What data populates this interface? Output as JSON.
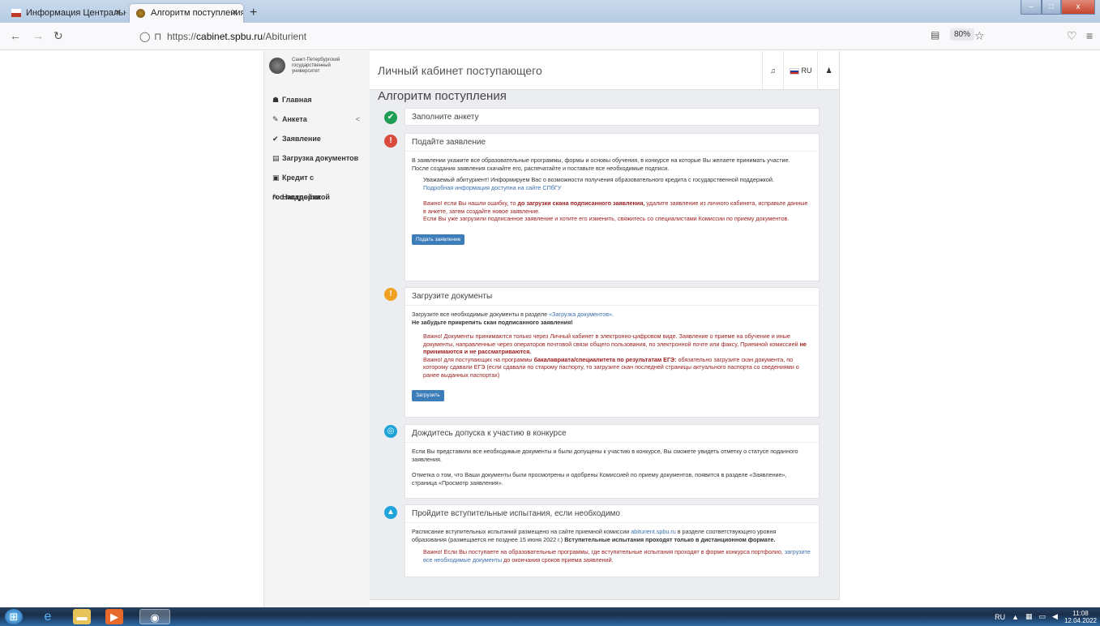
{
  "browser": {
    "tabs": [
      {
        "label": "Информация Центральной ко"
      },
      {
        "label": "Алгоритм поступления"
      }
    ],
    "new_tab": "+",
    "url_prefix": "https://",
    "url_host": "cabinet.spbu.ru",
    "url_path": "/Abiturient",
    "zoom": "80%",
    "window_buttons": {
      "minimize": "–",
      "maximize": "□",
      "close": "x"
    }
  },
  "sidebar": {
    "logo_text": [
      "Санкт-Петербургский",
      "государственный",
      "университет"
    ],
    "items": [
      {
        "icon": "☗",
        "label": "Главная"
      },
      {
        "icon": "✎",
        "label": "Анкета",
        "chevron": "<"
      },
      {
        "icon": "✔",
        "label": "Заявление"
      },
      {
        "icon": "▤",
        "label": "Загрузка документов"
      },
      {
        "icon": "▣",
        "label": "Кредит с гос.поддержкой"
      },
      {
        "icon": "✎",
        "label": "Настройки"
      }
    ]
  },
  "header": {
    "title": "Личный кабинет поступающего",
    "lang": "RU"
  },
  "main": {
    "title": "Алгоритм поступления",
    "steps": [
      {
        "status": "done",
        "color": "#1f9d55",
        "icon": "✔",
        "title": "Заполните анкету"
      },
      {
        "status": "error",
        "color": "#d94b3c",
        "icon": "!",
        "title": "Подайте заявление",
        "p1": "В заявлении укажите все образовательные программы, формы и основы обучения, в конкурсе на которые Вы желаете принимать участие.",
        "p2": "После создания заявления скачайте его, распечатайте и поставьте все необходимые подписи.",
        "q1": "Уважаемый абитуриент! Информируем Вас о возможности получения образовательного кредита с государственной поддержкой.",
        "q1_link": "Подробная информация доступна на сайте СПбГУ",
        "w1_pre": "Важно! если Вы нашли ошибку, то ",
        "w1_bold": "до загрузки скана подписанного заявления,",
        "w1_post": " удалите заявление из личного кабинета, исправьте данные в анкете, затем создайте новое заявление.",
        "w2": "Если Вы уже загрузили подписанное заявление и хотите его изменить, свяжитесь со специалистами Комиссии по приему документов.",
        "button": "Подать заявление"
      },
      {
        "status": "warning",
        "color": "#f0a020",
        "icon": "!",
        "title": "Загрузите документы",
        "p1": "Загрузите все необходимые документы в разделе ",
        "p1_link": "«Загрузка документов».",
        "p2": "Не забудьте прикрепить скан подписанного заявления!",
        "w1": "Важно! Документы принимаются только через Личный кабинет в электронно-цифровом виде. Заявление о приеме на обучение и иные документы, направленные через операторов почтовой связи общего пользования, по электронной почте или факсу, Приемной комиссией ",
        "w1_bold": "не принимаются и не рассматриваются.",
        "w2_pre": "Важно! для поступающих на программы ",
        "w2_bold": "бакалавриата/специалитета по результатам ЕГЭ:",
        "w2_post": " обязательно загрузите скан документа, по которому сдавали ЕГЭ (если сдавали по старому паспорту, то загрузите скан последней страницы актуального паспорта со сведениями о ранее выданных паспортах)",
        "button": "Загрузить"
      },
      {
        "status": "info",
        "color": "#1fa3d8",
        "icon": "◎",
        "title": "Дождитесь допуска к участию в конкурсе",
        "p1": "Если Вы представили все необходимые документы и были допущены к участию в конкурсе, Вы сможете увидеть отметку о статусе поданного заявления.",
        "p2": "Отметка о том, что Ваши документы были просмотрены и одобрены Комиссией по приему документов, появится в разделе «Заявление», страница «Просмотр заявления»."
      },
      {
        "status": "info",
        "color": "#1fa3d8",
        "icon": "▲",
        "title": "Пройдите вступительные испытания, если необходимо",
        "p1_pre": "Расписание вступительных испытаний размещено на сайте приемной комиссии ",
        "p1_link": "abiturient.spbu.ru",
        "p1_post": " в разделе соответствующего уровня образования (размещается не позднее 15 июня 2022 г.) ",
        "p1_bold": "Вступительные испытания проходят только в дистанционном формате.",
        "w1_pre": "Важно! Если Вы поступаете на образовательные программы, где вступительные испытания проходят в форме конкурса портфолио, ",
        "w1_link": "загрузите все необходимые документы",
        "w1_post": " до окончания сроков приема заявлений."
      }
    ]
  },
  "taskbar": {
    "lang": "RU",
    "time": "11:08",
    "date": "12.04.2022"
  }
}
